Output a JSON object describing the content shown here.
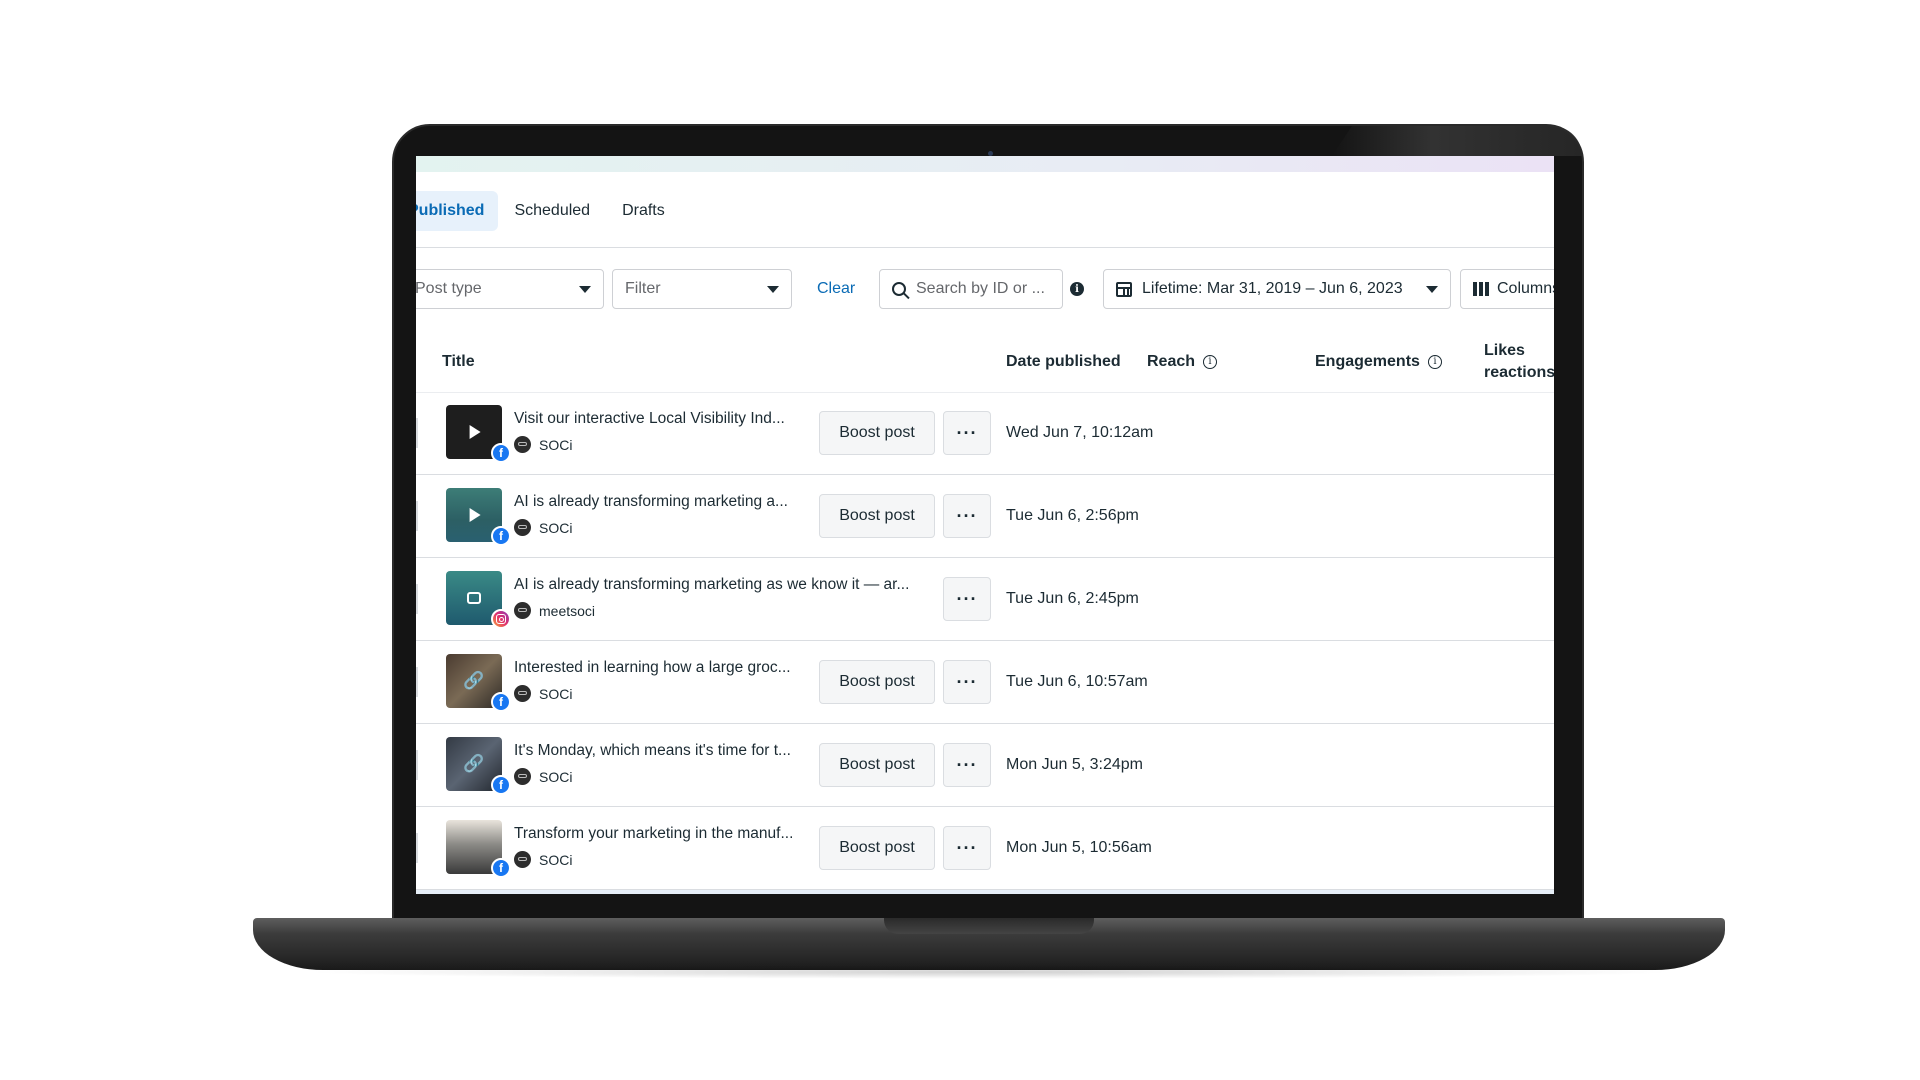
{
  "tabs": [
    {
      "label": "Published",
      "active": true
    },
    {
      "label": "Scheduled",
      "active": false
    },
    {
      "label": "Drafts",
      "active": false
    }
  ],
  "filters": {
    "post_type_placeholder": "Post type",
    "filter_placeholder": "Filter",
    "clear_label": "Clear",
    "search_placeholder": "Search by ID or ...",
    "info_glyph": "i",
    "date_range": "Lifetime: Mar 31, 2019 – Jun 6, 2023",
    "columns_label": "Columns"
  },
  "table": {
    "headers": {
      "title": "Title",
      "date_published": "Date published",
      "reach": "Reach",
      "engagements": "Engagements",
      "likes_line1": "Likes",
      "likes_line2": "reactions"
    },
    "rows": [
      {
        "title": "Visit our interactive Local Visibility Ind...",
        "account": "SOCi",
        "platform": "facebook",
        "media": "video",
        "boost": "Boost post",
        "more": "···",
        "date": "Wed Jun 7, 10:12am"
      },
      {
        "title": "AI is already transforming marketing a...",
        "account": "SOCi",
        "platform": "facebook",
        "media": "video",
        "boost": "Boost post",
        "more": "···",
        "date": "Tue Jun 6, 2:56pm"
      },
      {
        "title": "AI is already transforming marketing as we know it — ar...",
        "account": "meetsoci",
        "platform": "instagram",
        "media": "reel",
        "boost": "",
        "more": "···",
        "date": "Tue Jun 6, 2:45pm"
      },
      {
        "title": "Interested in learning how a large groc...",
        "account": "SOCi",
        "platform": "facebook",
        "media": "link",
        "boost": "Boost post",
        "more": "···",
        "date": "Tue Jun 6, 10:57am"
      },
      {
        "title": "It's Monday, which means it's time for t...",
        "account": "SOCi",
        "platform": "facebook",
        "media": "link",
        "boost": "Boost post",
        "more": "···",
        "date": "Mon Jun 5, 3:24pm"
      },
      {
        "title": "Transform your marketing in the manuf...",
        "account": "SOCi",
        "platform": "facebook",
        "media": "image",
        "boost": "Boost post",
        "more": "···",
        "date": "Mon Jun 5, 10:56am"
      }
    ]
  },
  "icons": {
    "facebook_badge": "f",
    "link_glyph": "🔗"
  },
  "colors": {
    "accent": "#0a6bb5",
    "facebook": "#1877f2"
  }
}
